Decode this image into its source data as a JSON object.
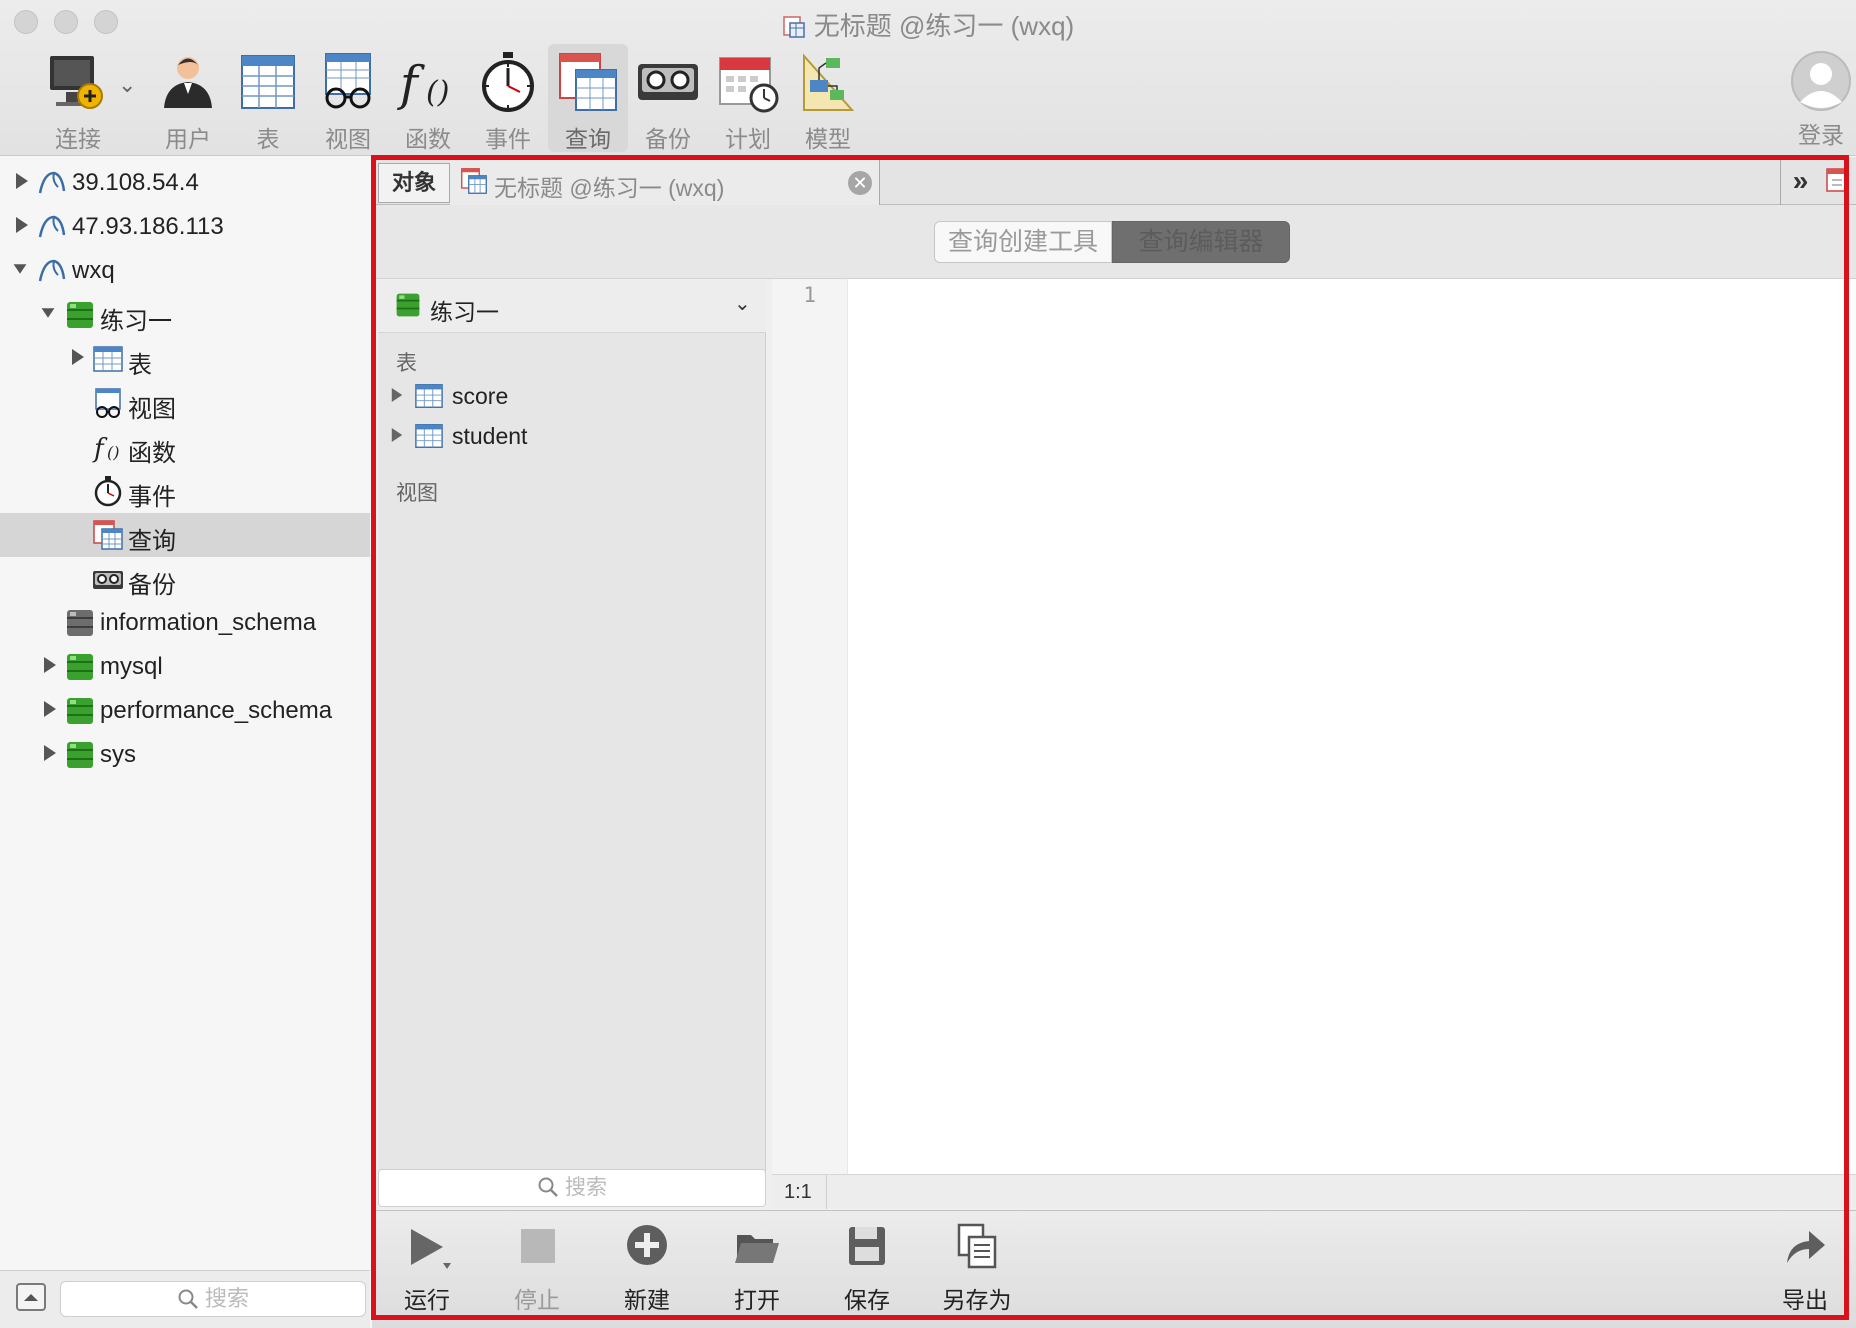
{
  "window": {
    "title": "无标题 @练习一 (wxq)"
  },
  "toolbar": {
    "items": [
      {
        "label": "连接",
        "icon": "connection-icon"
      },
      {
        "label": "用户",
        "icon": "user-icon"
      },
      {
        "label": "表",
        "icon": "table-icon"
      },
      {
        "label": "视图",
        "icon": "view-icon"
      },
      {
        "label": "函数",
        "icon": "function-icon"
      },
      {
        "label": "事件",
        "icon": "stopwatch-icon"
      },
      {
        "label": "查询",
        "icon": "query-icon",
        "active": true
      },
      {
        "label": "备份",
        "icon": "backup-icon"
      },
      {
        "label": "计划",
        "icon": "calendar-icon"
      },
      {
        "label": "模型",
        "icon": "model-icon"
      }
    ],
    "login_label": "登录"
  },
  "sidebar": {
    "tree": [
      {
        "label": "39.108.54.4",
        "icon": "mysql-connection-icon",
        "level": 0,
        "expanded": false
      },
      {
        "label": "47.93.186.113",
        "icon": "mysql-connection-icon",
        "level": 0,
        "expanded": false
      },
      {
        "label": "wxq",
        "icon": "mysql-connection-icon",
        "level": 0,
        "expanded": true
      },
      {
        "label": "练习一",
        "icon": "database-green-icon",
        "level": 1,
        "expanded": true
      },
      {
        "label": "表",
        "icon": "table-icon",
        "level": 2,
        "expanded": false
      },
      {
        "label": "视图",
        "icon": "view-icon",
        "level": 2
      },
      {
        "label": "函数",
        "icon": "function-icon",
        "level": 2
      },
      {
        "label": "事件",
        "icon": "stopwatch-icon",
        "level": 2
      },
      {
        "label": "查询",
        "icon": "query-icon",
        "level": 2,
        "selected": true
      },
      {
        "label": "备份",
        "icon": "backup-icon",
        "level": 2
      },
      {
        "label": "information_schema",
        "icon": "database-grey-icon",
        "level": 1
      },
      {
        "label": "mysql",
        "icon": "database-green-icon",
        "level": 1,
        "expanded": false
      },
      {
        "label": "performance_schema",
        "icon": "database-green-icon",
        "level": 1,
        "expanded": false
      },
      {
        "label": "sys",
        "icon": "database-green-icon",
        "level": 1,
        "expanded": false
      }
    ],
    "search_placeholder": "搜索"
  },
  "tabs": {
    "objects_label": "对象",
    "query_tab_label": "无标题 @练习一 (wxq)",
    "more_label": "»"
  },
  "segmented": {
    "builder_label": "查询创建工具",
    "editor_label": "查询编辑器",
    "selected": "editor"
  },
  "object_panel": {
    "database": "练习一",
    "tables_header": "表",
    "tables": [
      "score",
      "student"
    ],
    "views_header": "视图",
    "search_placeholder": "搜索"
  },
  "editor": {
    "line_numbers": [
      "1"
    ],
    "cursor_position": "1:1"
  },
  "bottom_toolbar": {
    "items": [
      {
        "label": "运行",
        "icon": "play-icon",
        "enabled": true
      },
      {
        "label": "停止",
        "icon": "stop-icon",
        "enabled": false
      },
      {
        "label": "新建",
        "icon": "add-circle-icon",
        "enabled": true
      },
      {
        "label": "打开",
        "icon": "folder-open-icon",
        "enabled": true
      },
      {
        "label": "保存",
        "icon": "save-icon",
        "enabled": true
      },
      {
        "label": "另存为",
        "icon": "save-as-icon",
        "enabled": true
      }
    ],
    "export_label": "导出"
  },
  "colors": {
    "highlight_frame": "#d9111b",
    "db_green": "#3aa12f",
    "selected_row": "#d6d6d6"
  }
}
